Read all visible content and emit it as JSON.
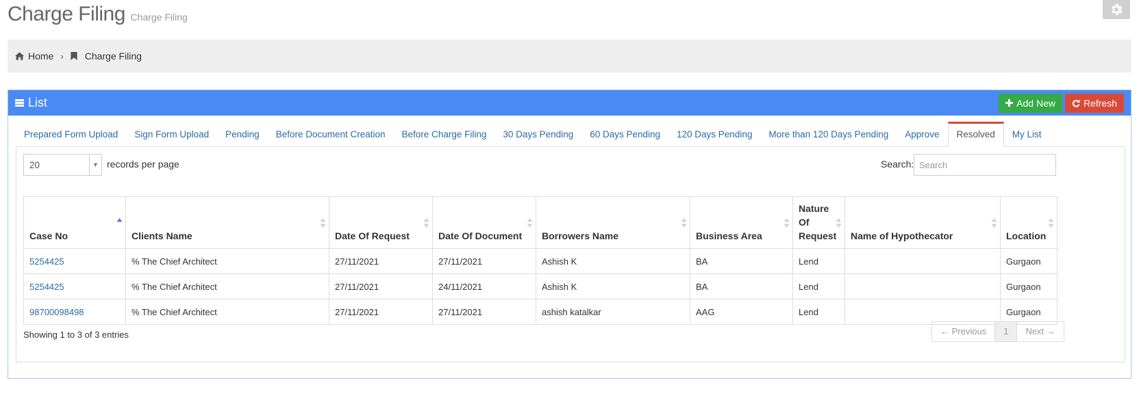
{
  "page": {
    "title": "Charge Filing",
    "subtitle": "Charge Filing"
  },
  "breadcrumb": {
    "home_label": "Home",
    "current_label": "Charge Filing"
  },
  "portlet": {
    "caption": "List",
    "add_new_label": "Add New",
    "refresh_label": "Refresh"
  },
  "tabs": [
    {
      "label": "Prepared Form Upload"
    },
    {
      "label": "Sign Form Upload"
    },
    {
      "label": "Pending"
    },
    {
      "label": "Before Document Creation"
    },
    {
      "label": "Before Charge Filing"
    },
    {
      "label": "30 Days Pending"
    },
    {
      "label": "60 Days Pending"
    },
    {
      "label": "120 Days Pending"
    },
    {
      "label": "More than 120 Days Pending"
    },
    {
      "label": "Approve"
    },
    {
      "label": "Resolved",
      "active": true
    },
    {
      "label": "My List"
    }
  ],
  "controls": {
    "page_length_value": "20",
    "page_length_label": "records per page",
    "search_label": "Search:",
    "search_placeholder": "Search"
  },
  "table": {
    "columns": [
      {
        "label": "Case No",
        "sorted": "asc"
      },
      {
        "label": "Clients Name"
      },
      {
        "label": "Date Of Request"
      },
      {
        "label": "Date Of Document"
      },
      {
        "label": "Borrowers Name"
      },
      {
        "label": "Business Area"
      },
      {
        "label": "Nature Of Request"
      },
      {
        "label": "Name of Hypothecator"
      },
      {
        "label": "Location"
      }
    ],
    "rows": [
      {
        "case_no": "5254425",
        "client": "% The Chief Architect",
        "date_request": "27/11/2021",
        "date_document": "27/11/2021",
        "borrower": "Ashish K",
        "business_area": "BA",
        "nature": "Lend",
        "hypothecator": "",
        "location": "Gurgaon"
      },
      {
        "case_no": "5254425",
        "client": "% The Chief Architect",
        "date_request": "27/11/2021",
        "date_document": "24/11/2021",
        "borrower": "Ashish K",
        "business_area": "BA",
        "nature": "Lend",
        "hypothecator": "",
        "location": "Gurgaon"
      },
      {
        "case_no": "98700098498",
        "client": "% The Chief Architect",
        "date_request": "27/11/2021",
        "date_document": "27/11/2021",
        "borrower": "ashish katalkar",
        "business_area": "AAG",
        "nature": "Lend",
        "hypothecator": "",
        "location": "Gurgaon"
      }
    ]
  },
  "footer": {
    "info": "Showing 1 to 3 of 3 entries",
    "prev_label": "← Previous",
    "page_label": "1",
    "next_label": "Next →"
  },
  "colors": {
    "header_blue": "#4a8af4",
    "add_green": "#35aa47",
    "refresh_red": "#d84a38",
    "link_blue": "#2c6aa6"
  },
  "icons": {
    "home": "home-icon",
    "bookmark": "bookmark-icon",
    "list": "list-icon",
    "plus": "plus-icon",
    "refresh": "refresh-icon",
    "settings": "gear-icon"
  }
}
